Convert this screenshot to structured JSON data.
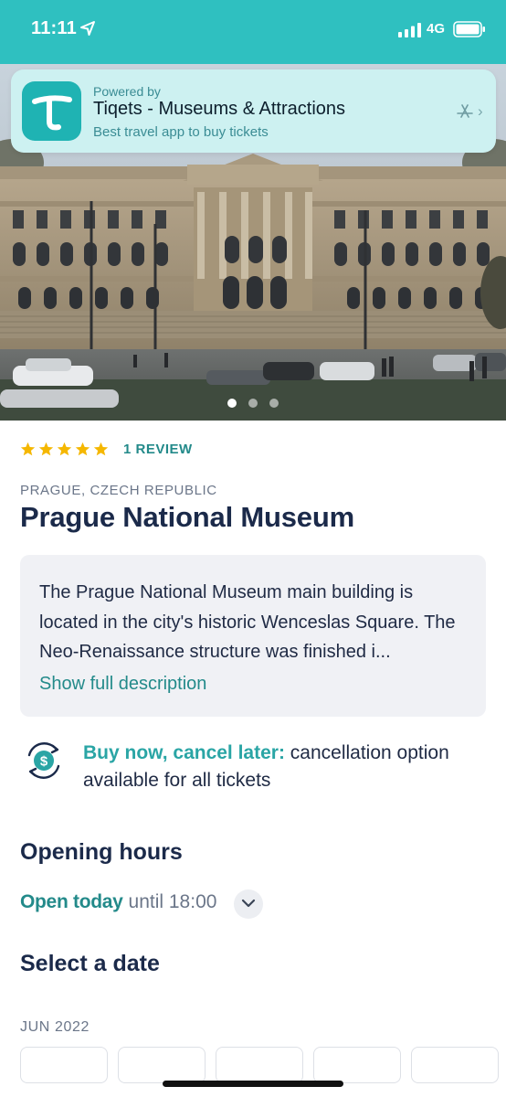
{
  "status_bar": {
    "time": "11:11",
    "network": "4G"
  },
  "app_banner": {
    "powered_by": "Powered by",
    "app_name": "Tiqets - Museums & Attractions",
    "tagline": "Best travel app to buy tickets",
    "icon_letter": "T"
  },
  "gallery": {
    "slides": 3,
    "active_slide": 1
  },
  "rating": {
    "stars": 5,
    "reviews_label": "1 REVIEW"
  },
  "location": "PRAGUE, CZECH REPUBLIC",
  "title": "Prague National Museum",
  "description": {
    "text": "The Prague National Museum main building is located in the city's historic Wenceslas Square. The Neo-Renaissance structure was finished i...",
    "show_more_label": "Show full description"
  },
  "cancellation": {
    "highlight": "Buy now, cancel later:",
    "text": " cancellation option available for all tickets"
  },
  "opening_hours": {
    "heading": "Opening hours",
    "status": "Open today",
    "until": "until 18:00"
  },
  "date_picker": {
    "heading": "Select a date",
    "month": "JUN 2022"
  },
  "colors": {
    "brand_teal": "#2fc0c0",
    "accent_text": "#238a8a",
    "star_gold": "#f5b700",
    "title_navy": "#1b2a4a"
  }
}
